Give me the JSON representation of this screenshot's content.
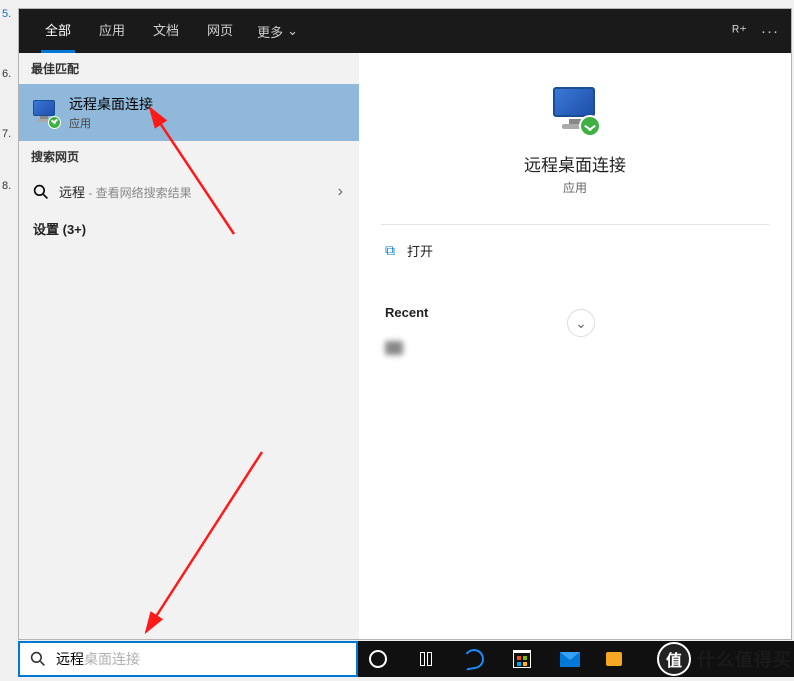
{
  "line_numbers": {
    "n1": "5.",
    "n2": "6.",
    "n3": "7.",
    "n4": "8."
  },
  "tabs": {
    "all": "全部",
    "apps": "应用",
    "documents": "文档",
    "web": "网页",
    "more": "更多"
  },
  "sections": {
    "best_match": "最佳匹配",
    "search_web": "搜索网页",
    "settings_group": "设置 (3+)"
  },
  "best_match_item": {
    "title": "远程桌面连接",
    "subtitle": "应用"
  },
  "web_search": {
    "term": "远程",
    "suffix": " - 查看网络搜索结果"
  },
  "detail": {
    "title": "远程桌面连接",
    "subtitle": "应用",
    "open_label": "打开",
    "recent_header": "Recent",
    "recent_item": "　　　　　　"
  },
  "taskbar_search": {
    "typed": "远程",
    "completion": "桌面连接"
  },
  "watermark": {
    "badge": "值",
    "text": "什么值得买"
  }
}
